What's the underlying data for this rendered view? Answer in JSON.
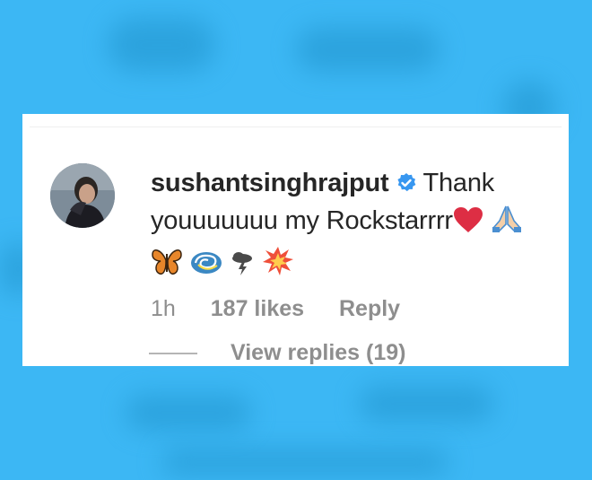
{
  "comment": {
    "username": "sushantsinghrajput",
    "verified": true,
    "text": "Thank youuuuuuu my Rockstarrrr",
    "emojis_inline": [
      "heart-emoji",
      "folded-hands-emoji"
    ],
    "emojis_row": [
      "butterfly-emoji",
      "cyclone-emoji",
      "lightning-cloud-emoji",
      "collision-emoji"
    ],
    "time": "1h",
    "likes": "187 likes",
    "reply_label": "Reply",
    "view_replies": "View replies (19)"
  },
  "colors": {
    "background": "#3cb7f4",
    "card": "#ffffff",
    "text": "#262626",
    "meta": "#8e8e8e",
    "verified_blue": "#3897f0"
  }
}
